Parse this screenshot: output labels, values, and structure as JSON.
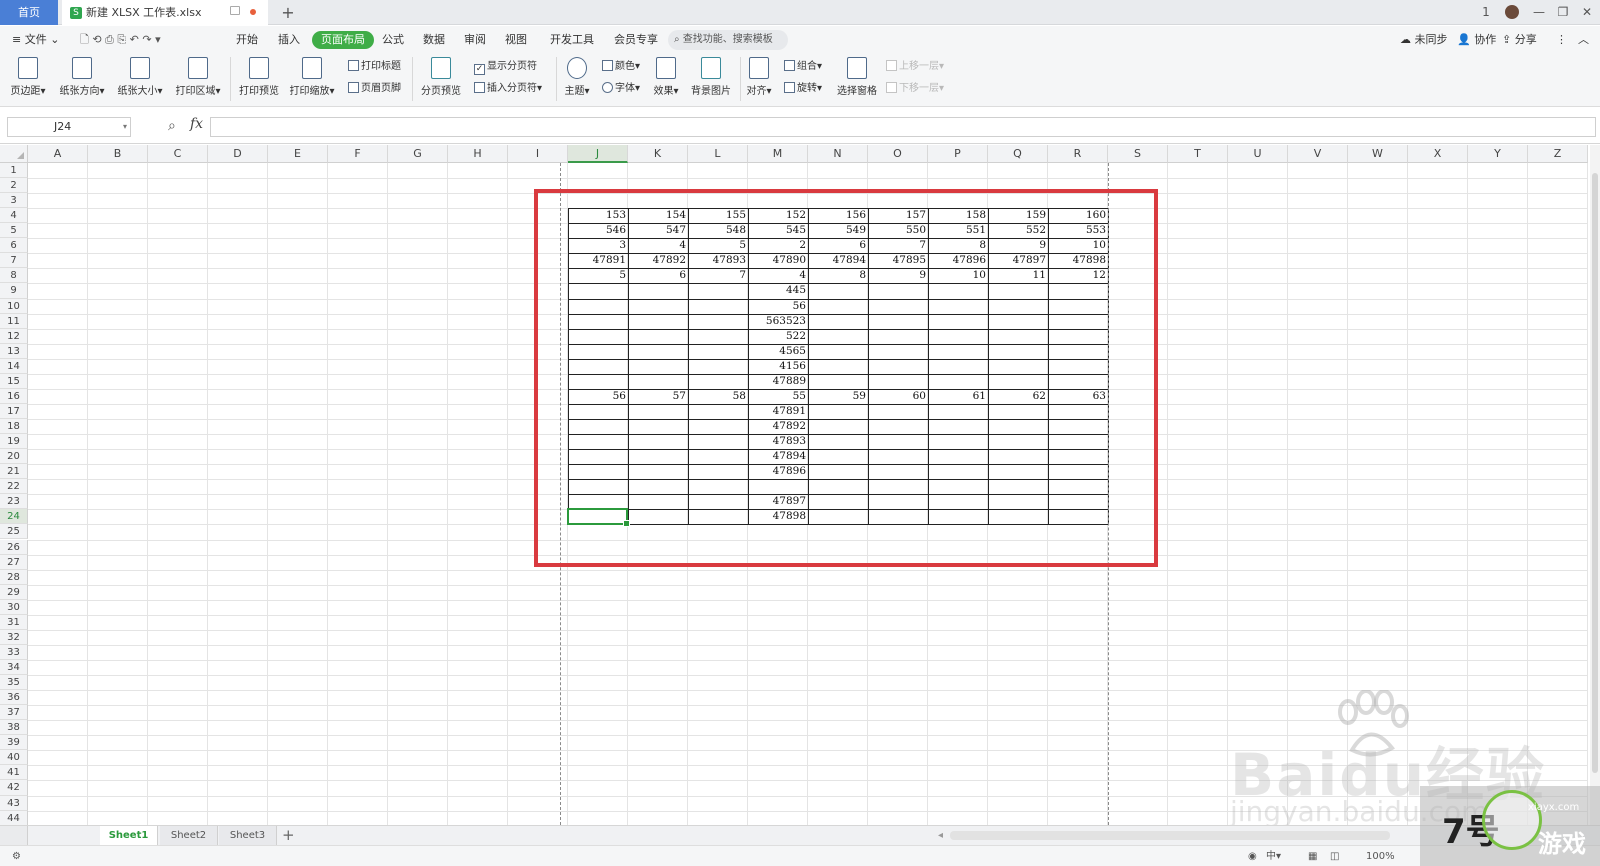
{
  "titlebar": {
    "home_tab": "首页",
    "file_tab": "新建 XLSX 工作表.xlsx",
    "file_icon": "S",
    "new_tab": "+",
    "controls": [
      "1",
      "—",
      "❐",
      "✕"
    ]
  },
  "menu": {
    "file_label": "文件",
    "items": [
      "开始",
      "插入",
      "页面布局",
      "公式",
      "数据",
      "审阅",
      "视图",
      "开发工具",
      "会员专享"
    ],
    "active": "页面布局",
    "search_placeholder": "查找功能、搜索模板",
    "right": {
      "sync": "未同步",
      "collab": "协作",
      "share": "分享"
    }
  },
  "ribbon": {
    "margins": "页边距",
    "orientation": "纸张方向",
    "size": "纸张大小",
    "print_area": "打印区域",
    "print_preview": "打印预览",
    "print_scale": "打印缩放",
    "print_titles": "打印标题",
    "header_footer": "页眉页脚",
    "page_break_preview": "分页预览",
    "show_page_breaks": "显示分页符",
    "insert_page_break": "插入分页符",
    "theme": "主题",
    "colors": "颜色",
    "fonts": "字体",
    "effects": "效果",
    "background": "背景图片",
    "align": "对齐",
    "group": "组合",
    "rotate": "旋转",
    "selection_pane": "选择窗格",
    "bring_forward": "上移一层",
    "send_backward": "下移一层"
  },
  "formula_bar": {
    "name_box": "J24",
    "fx": "fx",
    "value": ""
  },
  "sheet": {
    "columns": [
      "A",
      "B",
      "C",
      "D",
      "E",
      "F",
      "G",
      "H",
      "I",
      "J",
      "K",
      "L",
      "M",
      "N",
      "O",
      "P",
      "Q",
      "R",
      "S",
      "T",
      "U",
      "V",
      "W",
      "X",
      "Y",
      "Z"
    ],
    "rows": [
      "1",
      "2",
      "3",
      "4",
      "5",
      "6",
      "7",
      "8",
      "9",
      "10",
      "11",
      "12",
      "13",
      "14",
      "15",
      "16",
      "17",
      "18",
      "19",
      "20",
      "21",
      "22",
      "23",
      "24",
      "25",
      "26",
      "27",
      "28",
      "29",
      "30",
      "31",
      "32",
      "33",
      "34",
      "35",
      "36",
      "37",
      "38",
      "39",
      "40",
      "41",
      "42",
      "43",
      "44"
    ],
    "selected_column": "J",
    "selected_row": "24",
    "table_columns": [
      "J",
      "K",
      "L",
      "M",
      "N",
      "O",
      "P",
      "Q",
      "R"
    ],
    "table_rows": [
      {
        "row": "4",
        "cells": [
          "153",
          "154",
          "155",
          "152",
          "156",
          "157",
          "158",
          "159",
          "160"
        ]
      },
      {
        "row": "5",
        "cells": [
          "546",
          "547",
          "548",
          "545",
          "549",
          "550",
          "551",
          "552",
          "553"
        ]
      },
      {
        "row": "6",
        "cells": [
          "3",
          "4",
          "5",
          "2",
          "6",
          "7",
          "8",
          "9",
          "10"
        ]
      },
      {
        "row": "7",
        "cells": [
          "47891",
          "47892",
          "47893",
          "47890",
          "47894",
          "47895",
          "47896",
          "47897",
          "47898"
        ]
      },
      {
        "row": "8",
        "cells": [
          "5",
          "6",
          "7",
          "4",
          "8",
          "9",
          "10",
          "11",
          "12"
        ]
      },
      {
        "row": "9",
        "cells": [
          "",
          "",
          "",
          "445",
          "",
          "",
          "",
          "",
          ""
        ]
      },
      {
        "row": "10",
        "cells": [
          "",
          "",
          "",
          "56",
          "",
          "",
          "",
          "",
          ""
        ]
      },
      {
        "row": "11",
        "cells": [
          "",
          "",
          "",
          "563523",
          "",
          "",
          "",
          "",
          ""
        ]
      },
      {
        "row": "12",
        "cells": [
          "",
          "",
          "",
          "522",
          "",
          "",
          "",
          "",
          ""
        ]
      },
      {
        "row": "13",
        "cells": [
          "",
          "",
          "",
          "4565",
          "",
          "",
          "",
          "",
          ""
        ]
      },
      {
        "row": "14",
        "cells": [
          "",
          "",
          "",
          "4156",
          "",
          "",
          "",
          "",
          ""
        ]
      },
      {
        "row": "15",
        "cells": [
          "",
          "",
          "",
          "47889",
          "",
          "",
          "",
          "",
          ""
        ]
      },
      {
        "row": "16",
        "cells": [
          "56",
          "57",
          "58",
          "55",
          "59",
          "60",
          "61",
          "62",
          "63"
        ]
      },
      {
        "row": "17",
        "cells": [
          "",
          "",
          "",
          "47891",
          "",
          "",
          "",
          "",
          ""
        ]
      },
      {
        "row": "18",
        "cells": [
          "",
          "",
          "",
          "47892",
          "",
          "",
          "",
          "",
          ""
        ]
      },
      {
        "row": "19",
        "cells": [
          "",
          "",
          "",
          "47893",
          "",
          "",
          "",
          "",
          ""
        ]
      },
      {
        "row": "20",
        "cells": [
          "",
          "",
          "",
          "47894",
          "",
          "",
          "",
          "",
          ""
        ]
      },
      {
        "row": "21",
        "cells": [
          "",
          "",
          "",
          "47896",
          "",
          "",
          "",
          "",
          ""
        ]
      },
      {
        "row": "22",
        "cells": [
          "",
          "",
          "",
          "",
          "",
          "",
          "",
          "",
          ""
        ]
      },
      {
        "row": "23",
        "cells": [
          "",
          "",
          "",
          "47897",
          "",
          "",
          "",
          "",
          ""
        ]
      },
      {
        "row": "24",
        "cells": [
          "",
          "",
          "",
          "47898",
          "",
          "",
          "",
          "",
          ""
        ]
      }
    ]
  },
  "sheet_tabs": {
    "tabs": [
      "Sheet1",
      "Sheet2",
      "Sheet3"
    ],
    "active": "Sheet1",
    "add": "+"
  },
  "status": {
    "zoom": "100%"
  },
  "watermark": {
    "baidu": "Baidu经验",
    "jingyan": "jingyan.baidu.com",
    "site": "xiayx.com",
    "site_big": "7号",
    "site_game": "游戏"
  },
  "colors": {
    "accent": "#3fad47",
    "highlight": "#d93a3f",
    "home_tab": "#4a7fd6"
  }
}
